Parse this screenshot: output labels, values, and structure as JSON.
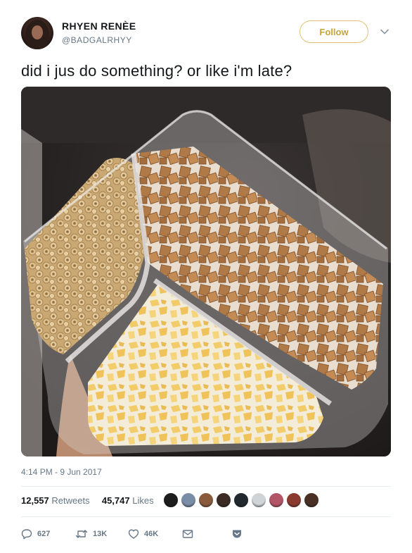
{
  "author": {
    "display_name": "RHYEN RENÈE",
    "handle": "@BADGALRHYY"
  },
  "follow_label": "Follow",
  "tweet": {
    "text": "did i jus do something? or like i'm late?",
    "timestamp": "4:14 PM - 9 Jun 2017"
  },
  "stats": {
    "retweets_count": "12,557",
    "retweets_label": "Retweets",
    "likes_count": "45,747",
    "likes_label": "Likes"
  },
  "liker_avatar_colors": [
    "#1d1d1d",
    "#7a8da6",
    "#8a5a3c",
    "#3c2b25",
    "#222a30",
    "#cfd4d8",
    "#b25566",
    "#8a3a2e",
    "#4a3024"
  ],
  "actions": {
    "reply_count": "627",
    "retweet_count": "13K",
    "like_count": "46K"
  },
  "colors": {
    "follow_accent": "#c8a437",
    "muted_text": "#657786",
    "primary_text": "#14171a"
  },
  "icons": [
    "avatar",
    "chevron-down-icon",
    "reply-icon",
    "retweet-icon",
    "heart-icon",
    "mail-icon",
    "pocket-icon"
  ]
}
